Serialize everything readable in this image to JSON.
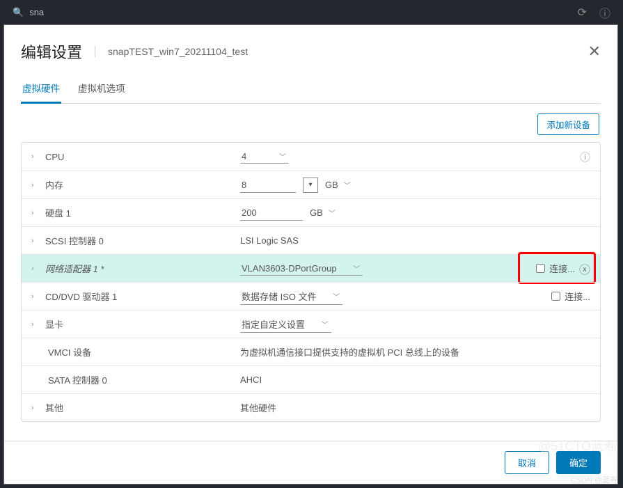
{
  "topbar": {
    "search_text": "sna",
    "refresh_icon": "⟳",
    "help_icon": "?"
  },
  "modal": {
    "title": "编辑设置",
    "subtitle": "snapTEST_win7_20211104_test",
    "tabs": {
      "hardware": "虚拟硬件",
      "options": "虚拟机选项"
    },
    "add_device": "添加新设备",
    "rows": {
      "cpu": {
        "label": "CPU",
        "value": "4"
      },
      "memory": {
        "label": "内存",
        "value": "8",
        "unit": "GB"
      },
      "disk1": {
        "label": "硬盘 1",
        "value": "200",
        "unit": "GB"
      },
      "scsi0": {
        "label": "SCSI 控制器 0",
        "value": "LSI Logic SAS"
      },
      "nic1": {
        "label": "网络适配器 1 *",
        "value": "VLAN3603-DPortGroup",
        "connect": "连接..."
      },
      "cd1": {
        "label": "CD/DVD 驱动器 1",
        "value": "数据存储 ISO 文件",
        "connect": "连接..."
      },
      "gpu": {
        "label": "显卡",
        "value": "指定自定义设置"
      },
      "vmci": {
        "label": "VMCI 设备",
        "value": "为虚拟机通信接口提供支持的虚拟机 PCI 总线上的设备"
      },
      "sata0": {
        "label": "SATA 控制器 0",
        "value": "AHCI"
      },
      "other": {
        "label": "其他",
        "value": "其他硬件"
      }
    },
    "footer": {
      "cancel": "取消",
      "ok": "确定"
    }
  },
  "watermark": {
    "line1": "@51CTO蓝寿",
    "line2": "CSDN @蓝寿"
  }
}
